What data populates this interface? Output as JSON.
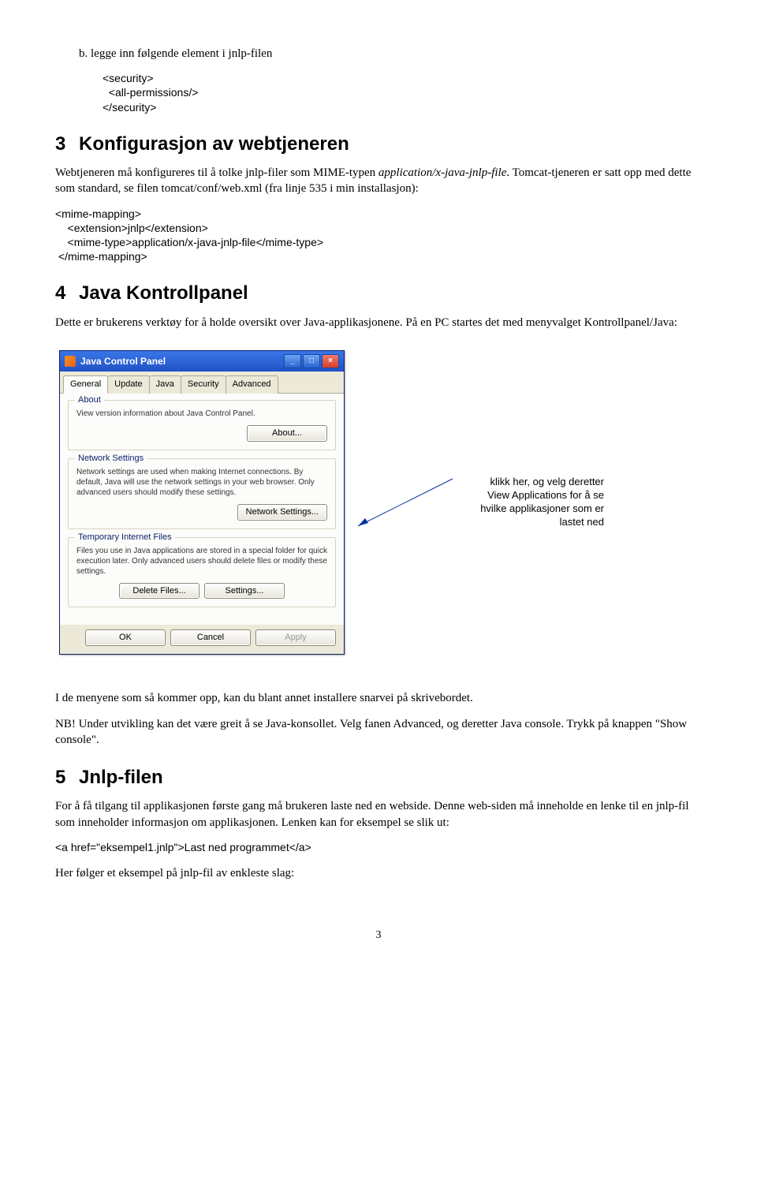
{
  "section_b": {
    "intro": "b.   legge inn følgende element i jnlp-filen",
    "code": "<security>\n  <all-permissions/>\n</security>"
  },
  "h3": {
    "num": "3",
    "title": "Konfigurasjon av webtjeneren"
  },
  "p3a_pre": "Webtjeneren må konfigureres til å tolke jnlp-filer som MIME-typen ",
  "p3a_ital": "application/x-java-jnlp-file",
  "p3a_post": ". Tomcat-tjeneren er satt opp med dette som standard, se filen tomcat/conf/web.xml (fra linje 535 i min installasjon):",
  "code3": "<mime-mapping>\n    <extension>jnlp</extension>\n    <mime-type>application/x-java-jnlp-file</mime-type>\n </mime-mapping>",
  "h4": {
    "num": "4",
    "title": "Java Kontrollpanel"
  },
  "p4": "Dette er brukerens verktøy for å holde oversikt over Java-applikasjonene. På en PC startes det med menyvalget Kontrollpanel/Java:",
  "jcp": {
    "title": "Java Control Panel",
    "tabs": [
      "General",
      "Update",
      "Java",
      "Security",
      "Advanced"
    ],
    "about": {
      "legend": "About",
      "text": "View version information about Java Control Panel.",
      "btn": "About..."
    },
    "net": {
      "legend": "Network Settings",
      "text": "Network settings are used when making Internet connections. By default, Java will use the network settings in your web browser. Only advanced users should modify these settings.",
      "btn": "Network Settings..."
    },
    "temp": {
      "legend": "Temporary Internet Files",
      "text": "Files you use in Java applications are stored in a special folder for quick execution later. Only advanced users should delete files or modify these settings.",
      "btn_del": "Delete Files...",
      "btn_set": "Settings..."
    },
    "footer": {
      "ok": "OK",
      "cancel": "Cancel",
      "apply": "Apply"
    }
  },
  "callout": "klikk her, og velg deretter View Applications for å se hvilke applikasjoner som er lastet ned",
  "p_after1": "I de menyene som så kommer opp, kan du blant annet installere snarvei på skrivebordet.",
  "p_after2": "NB! Under utvikling kan det være greit å se Java-konsollet. Velg fanen Advanced, og deretter Java console. Trykk på knappen \"Show console\".",
  "h5": {
    "num": "5",
    "title": "Jnlp-filen"
  },
  "p5": "For å få tilgang til applikasjonen første gang må brukeren laste ned en webside. Denne web-siden må inneholde en lenke til en jnlp-fil som inneholder informasjon om applikasjonen. Lenken kan for eksempel se slik ut:",
  "code5": "<a href=\"eksempel1.jnlp\">Last ned programmet</a>",
  "p5b": "Her følger et eksempel på jnlp-fil av enkleste slag:",
  "pagenum": "3"
}
